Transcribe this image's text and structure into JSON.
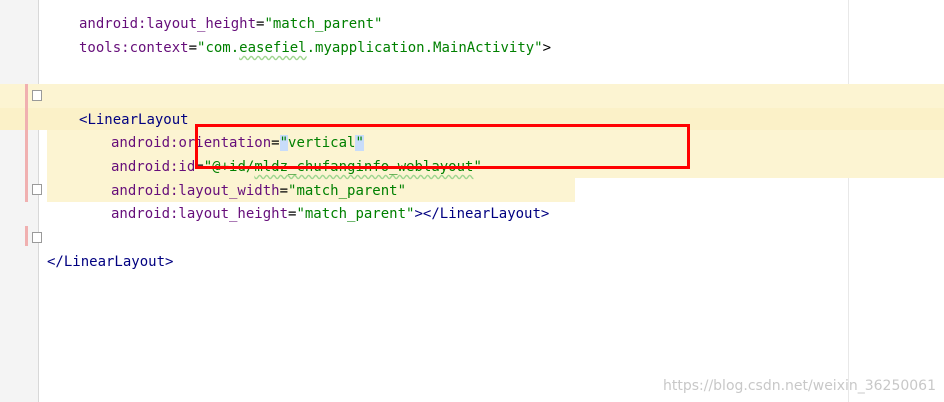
{
  "editor": {
    "lines": {
      "l1_attr": "android:layout_height",
      "l1_eq": "=",
      "l1_val": "\"match_parent\"",
      "l2_attr": "tools:context",
      "l2_eq": "=",
      "l2_val_pre": "\"com.",
      "l2_val_mid": "easefiel",
      "l2_val_post": ".myapplication.MainActivity\"",
      "l2_close": ">",
      "l3_open": "<",
      "l3_tag": "LinearLayout",
      "l4_attr_a": "android:",
      "l4_attr_b": "orientation",
      "l4_eq": "=",
      "l4_q1": "\"",
      "l4_val": "vertical",
      "l4_q2": "\"",
      "l5_attr": "android:id",
      "l5_eq": "=",
      "l5_val_pre": "\"@+id/",
      "l5_val_mid": "mldz_chufanginfo_weblayout",
      "l5_val_post": "\"",
      "l6_attr": "android:layout_width",
      "l6_eq": "=",
      "l6_val": "\"match_parent\"",
      "l7_attr": "android:layout_height",
      "l7_eq": "=",
      "l7_val": "\"match_parent\"",
      "l7_close": "></",
      "l7_tag": "LinearLayout",
      "l7_end": ">",
      "l8_open": "</",
      "l8_tag": "LinearLayout",
      "l8_end": ">"
    }
  },
  "watermark": "https://blog.csdn.net/weixin_36250061",
  "colors": {
    "highlight": "#fcf4d2",
    "annotation_box": "#ff0000",
    "attribute": "#660e7a",
    "tag": "#000080",
    "value": "#008000"
  }
}
